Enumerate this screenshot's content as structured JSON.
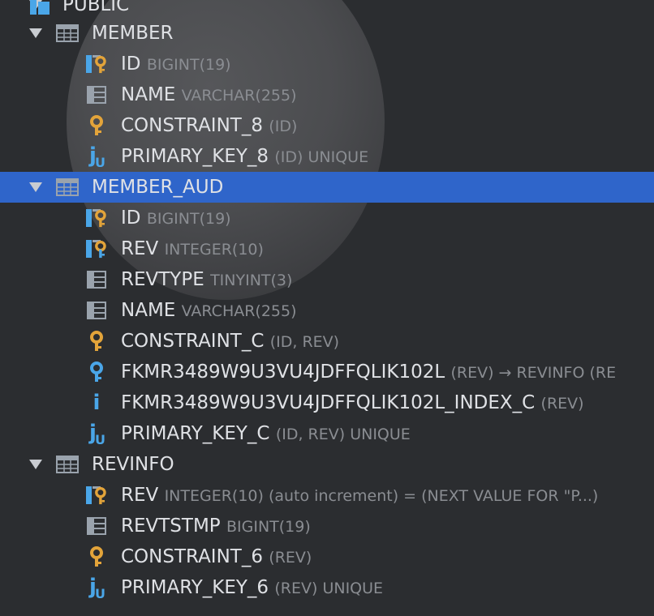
{
  "schema": {
    "label": "PUBLIC"
  },
  "tables": [
    {
      "name": "MEMBER",
      "expanded": true,
      "selected": false,
      "children": [
        {
          "kind": "pk-column",
          "icon": "primary-key-column-icon",
          "name": "ID",
          "meta": "BIGINT(19)"
        },
        {
          "kind": "column",
          "icon": "column-icon",
          "name": "NAME",
          "meta": "VARCHAR(255)"
        },
        {
          "kind": "key",
          "icon": "key-icon",
          "name": "CONSTRAINT_8",
          "meta": "(ID)"
        },
        {
          "kind": "unique-index",
          "icon": "unique-index-icon",
          "name": "PRIMARY_KEY_8",
          "meta": "(ID) UNIQUE"
        }
      ]
    },
    {
      "name": "MEMBER_AUD",
      "expanded": true,
      "selected": true,
      "children": [
        {
          "kind": "pk-column",
          "icon": "primary-key-column-icon",
          "name": "ID",
          "meta": "BIGINT(19)"
        },
        {
          "kind": "pk-fk-column",
          "icon": "primary-foreign-key-column-icon",
          "name": "REV",
          "meta": "INTEGER(10)"
        },
        {
          "kind": "column",
          "icon": "column-icon",
          "name": "REVTYPE",
          "meta": "TINYINT(3)"
        },
        {
          "kind": "column",
          "icon": "column-icon",
          "name": "NAME",
          "meta": "VARCHAR(255)"
        },
        {
          "kind": "key",
          "icon": "key-icon",
          "name": "CONSTRAINT_C",
          "meta": "(ID, REV)"
        },
        {
          "kind": "foreign-key",
          "icon": "foreign-key-icon",
          "name": "FKMR3489W9U3VU4JDFFQLIK102L",
          "meta": "(REV) → REVINFO (RE"
        },
        {
          "kind": "index",
          "icon": "index-icon",
          "name": "FKMR3489W9U3VU4JDFFQLIK102L_INDEX_C",
          "meta": "(REV)"
        },
        {
          "kind": "unique-index",
          "icon": "unique-index-icon",
          "name": "PRIMARY_KEY_C",
          "meta": "(ID, REV) UNIQUE"
        }
      ]
    },
    {
      "name": "REVINFO",
      "expanded": true,
      "selected": false,
      "children": [
        {
          "kind": "pk-column",
          "icon": "primary-key-column-icon",
          "name": "REV",
          "meta": "INTEGER(10) (auto increment) = (NEXT VALUE FOR \"P...)"
        },
        {
          "kind": "column",
          "icon": "column-icon",
          "name": "REVTSTMP",
          "meta": "BIGINT(19)"
        },
        {
          "kind": "key",
          "icon": "key-icon",
          "name": "CONSTRAINT_6",
          "meta": "(REV)"
        },
        {
          "kind": "unique-index",
          "icon": "unique-index-icon",
          "name": "PRIMARY_KEY_6",
          "meta": "(REV) UNIQUE"
        }
      ]
    }
  ],
  "colors": {
    "background": "#2b2d30",
    "selection": "#2f65ca",
    "text": "#dfe1e5",
    "meta_text": "#8a8d92",
    "key_gold": "#e3a43a",
    "blue_icon": "#4aa6e8",
    "table_icon": "#9aa3ad"
  }
}
